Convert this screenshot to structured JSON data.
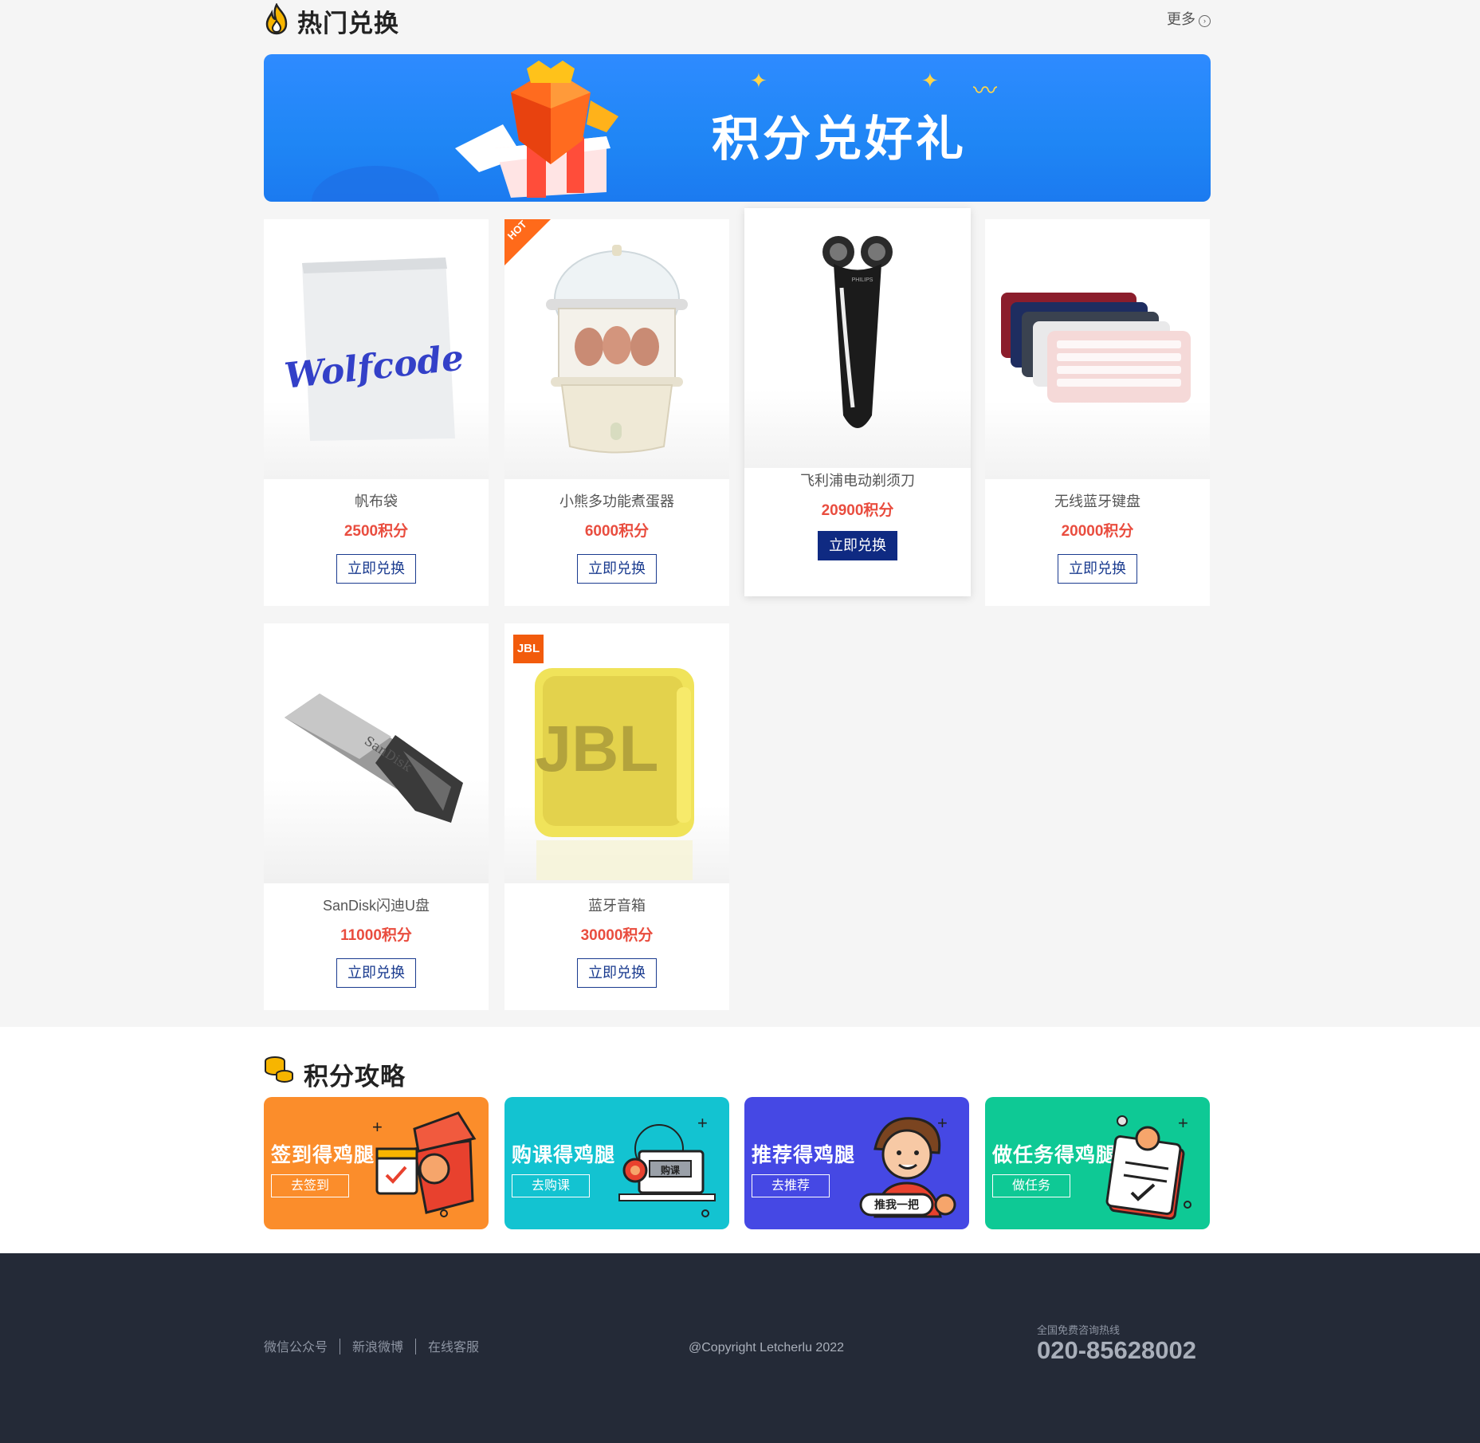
{
  "hot_section": {
    "title": "热门兑换",
    "more_label": "更多",
    "banner_text": "积分兑好礼"
  },
  "products": [
    {
      "name": "帆布袋",
      "price": "2500积分",
      "button": "立即兑换",
      "badge": "",
      "image_text": "Wolfcode"
    },
    {
      "name": "小熊多功能煮蛋器",
      "price": "6000积分",
      "button": "立即兑换",
      "badge": "HOT",
      "image_text": ""
    },
    {
      "name": "飞利浦电动剃须刀",
      "price": "20900积分",
      "button": "立即兑换",
      "badge": "",
      "image_text": "PHILIPS"
    },
    {
      "name": "无线蓝牙键盘",
      "price": "20000积分",
      "button": "立即兑换",
      "badge": "",
      "image_text": ""
    },
    {
      "name": "SanDisk闪迪U盘",
      "price": "11000积分",
      "button": "立即兑换",
      "badge": "",
      "image_text": "SanDisk"
    },
    {
      "name": "蓝牙音箱",
      "price": "30000积分",
      "button": "立即兑换",
      "badge": "JBL",
      "image_text": "JBL"
    }
  ],
  "strategy_section": {
    "title": "积分攻略",
    "cards": [
      {
        "title": "签到得鸡腿",
        "button": "去签到",
        "color": "#fb8d2b"
      },
      {
        "title": "购课得鸡腿",
        "button": "去购课",
        "color": "#13c3d1",
        "art_text": "购课"
      },
      {
        "title": "推荐得鸡腿",
        "button": "去推荐",
        "color": "#4548e4",
        "art_text": "推我一把"
      },
      {
        "title": "做任务得鸡腿",
        "button": "做任务",
        "color": "#0ec995"
      }
    ]
  },
  "footer": {
    "links": [
      "微信公众号",
      "新浪微博",
      "在线客服"
    ],
    "copyright": "@Copyright Letcherlu 2022",
    "hotline_label": "全国免费咨询热线",
    "hotline_number": "020-85628002"
  }
}
